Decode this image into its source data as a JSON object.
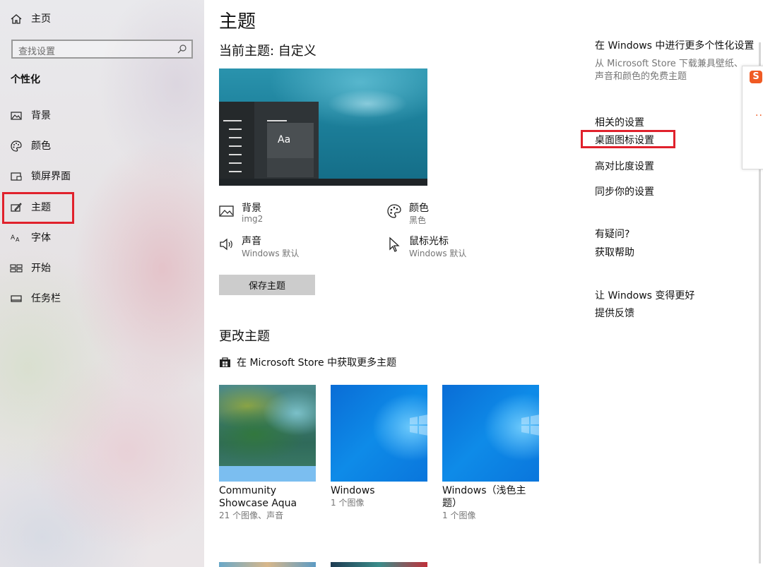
{
  "sidebar": {
    "home_label": "主页",
    "search_placeholder": "查找设置",
    "section_title": "个性化",
    "items": [
      {
        "label": "背景",
        "icon": "picture-icon"
      },
      {
        "label": "颜色",
        "icon": "palette-icon"
      },
      {
        "label": "锁屏界面",
        "icon": "lockscreen-icon"
      },
      {
        "label": "主题",
        "icon": "theme-brush-icon",
        "selected": true
      },
      {
        "label": "字体",
        "icon": "font-icon"
      },
      {
        "label": "开始",
        "icon": "start-icon"
      },
      {
        "label": "任务栏",
        "icon": "taskbar-icon"
      }
    ]
  },
  "main": {
    "title": "主题",
    "current_theme_label": "当前主题: 自定义",
    "preview": {
      "sample_text": "Aa"
    },
    "properties": {
      "background": {
        "title": "背景",
        "value": "img2",
        "icon": "picture-icon"
      },
      "color": {
        "title": "颜色",
        "value": "黑色",
        "icon": "palette-icon"
      },
      "sound": {
        "title": "声音",
        "value": "Windows 默认",
        "icon": "speaker-icon"
      },
      "cursor": {
        "title": "鼠标光标",
        "value": "Windows 默认",
        "icon": "cursor-icon"
      }
    },
    "save_button": "保存主题",
    "change_theme_title": "更改主题",
    "store_link": "在 Microsoft Store 中获取更多主题",
    "themes": [
      {
        "name": "Community Showcase Aqua",
        "sub": "21 个图像、声音"
      },
      {
        "name": "Windows",
        "sub": "1 个图像"
      },
      {
        "name": "Windows（浅色主题）",
        "sub": "1 个图像"
      }
    ]
  },
  "right": {
    "more_title": "在 Windows 中进行更多个性化设置",
    "more_desc_1": "从 Microsoft Store 下载兼具壁纸、",
    "more_desc_2": "声音和颜色的免费主题",
    "related_title": "相关的设置",
    "related_links": [
      "桌面图标设置",
      "高对比度设置",
      "同步你的设置"
    ],
    "question_title": "有疑问?",
    "help_link": "获取帮助",
    "improve_title": "让 Windows 变得更好",
    "feedback_link": "提供反馈"
  },
  "ime": {
    "logo_text": "S",
    "dots": ".."
  },
  "colors": {
    "highlight": "#e0212c",
    "accent": "#0a78d7",
    "button": "#cccccc"
  }
}
